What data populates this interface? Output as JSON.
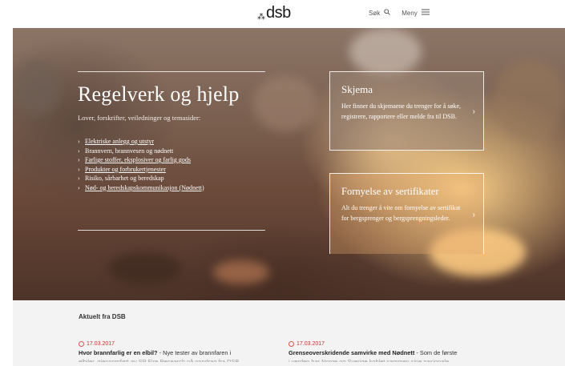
{
  "header": {
    "logo_text": "dsb",
    "logo_mark": "⁂",
    "search_label": "Søk",
    "search_icon": "search-icon",
    "menu_label": "Meny",
    "menu_icon": "hamburger-icon"
  },
  "hero": {
    "title": "Regelverk og hjelp",
    "subtitle": "Lover, forskrifter, veiledninger og temasider:",
    "links": [
      {
        "label": "Elektriske anlegg og utstyr",
        "underlined": true
      },
      {
        "label": "Brannvern, brannvesen og nødnett",
        "underlined": false
      },
      {
        "label": "Farlige stoffer, eksplosiver og farlig gods",
        "underlined": true
      },
      {
        "label": "Produkter og forbrukertjenester",
        "underlined": true
      },
      {
        "label": "Risiko, sårbarhet og beredskap",
        "underlined": false
      },
      {
        "label": "Nød- og beredskapskommunikasjon (Nødnett)",
        "underlined": true
      }
    ],
    "chevron": "›"
  },
  "cards": [
    {
      "title": "Skjema",
      "text": "Her finner du skjemaene du trenger for å søke, registrere, rapportere eller melde fra til DSB.",
      "arrow": "›"
    },
    {
      "title": "Fornyelse av sertifikater",
      "text": "Alt du trenger å vite om fornyelse av sertifikat for bergsprenger og bergsprengningsleder.",
      "arrow": "›"
    }
  ],
  "news": {
    "heading": "Aktuelt fra DSB",
    "items": [
      {
        "date": "17.03.2017",
        "headline": "Hvor brannfarlig er en elbil?",
        "summary": " - Nye tester av brannfaren i",
        "summary_cut": "elbiler, gjennomført av SP Fire Research på oppdrag fra DSB,"
      },
      {
        "date": "17.03.2017",
        "headline": "Grenseoverskridende samvirke med Nødnett",
        "summary": " - Som de første",
        "summary_cut": "i verden har Norge og Sverige koblet sammen sine nasjonale"
      }
    ]
  },
  "colors": {
    "accent": "#d9534f",
    "news_bg": "#f3f3f3"
  }
}
